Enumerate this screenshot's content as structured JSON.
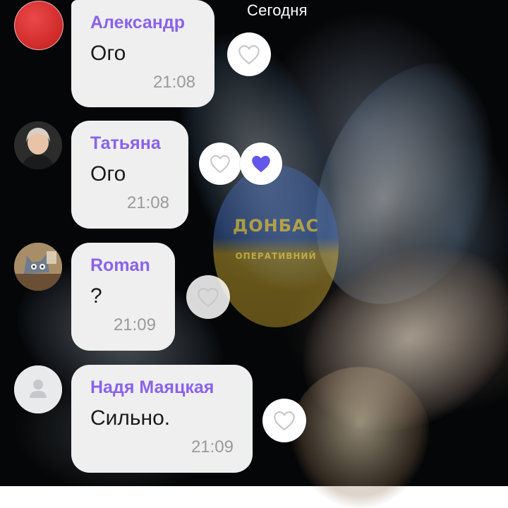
{
  "header": {
    "date_label": "Сегодня"
  },
  "watermark": {
    "line1": "ДОНБАС",
    "line2": "ОПЕРАТИВНИЙ"
  },
  "colors": {
    "sender_name": "#8a63e9",
    "bubble_bg": "#efefef",
    "time_text": "#9a9a9a",
    "liked_heart": "#6257e8"
  },
  "messages": [
    {
      "sender": "Александр",
      "text": "Ого",
      "time": "21:08",
      "avatar": "red-circle-avatar",
      "reaction": "heart-outline-icon"
    },
    {
      "sender": "Татьяна",
      "text": "Ого",
      "time": "21:08",
      "avatar": "user-photo-avatar",
      "reaction": "heart-outline-icon",
      "reaction_liked": "heart-filled-icon"
    },
    {
      "sender": "Roman",
      "text": "?",
      "time": "21:09",
      "avatar": "cartoon-cat-avatar",
      "reaction": "heart-outline-icon"
    },
    {
      "sender": "Надя Маяцкая",
      "text": "Сильно.",
      "time": "21:09",
      "avatar": "default-user-avatar",
      "reaction": "heart-outline-icon"
    }
  ]
}
